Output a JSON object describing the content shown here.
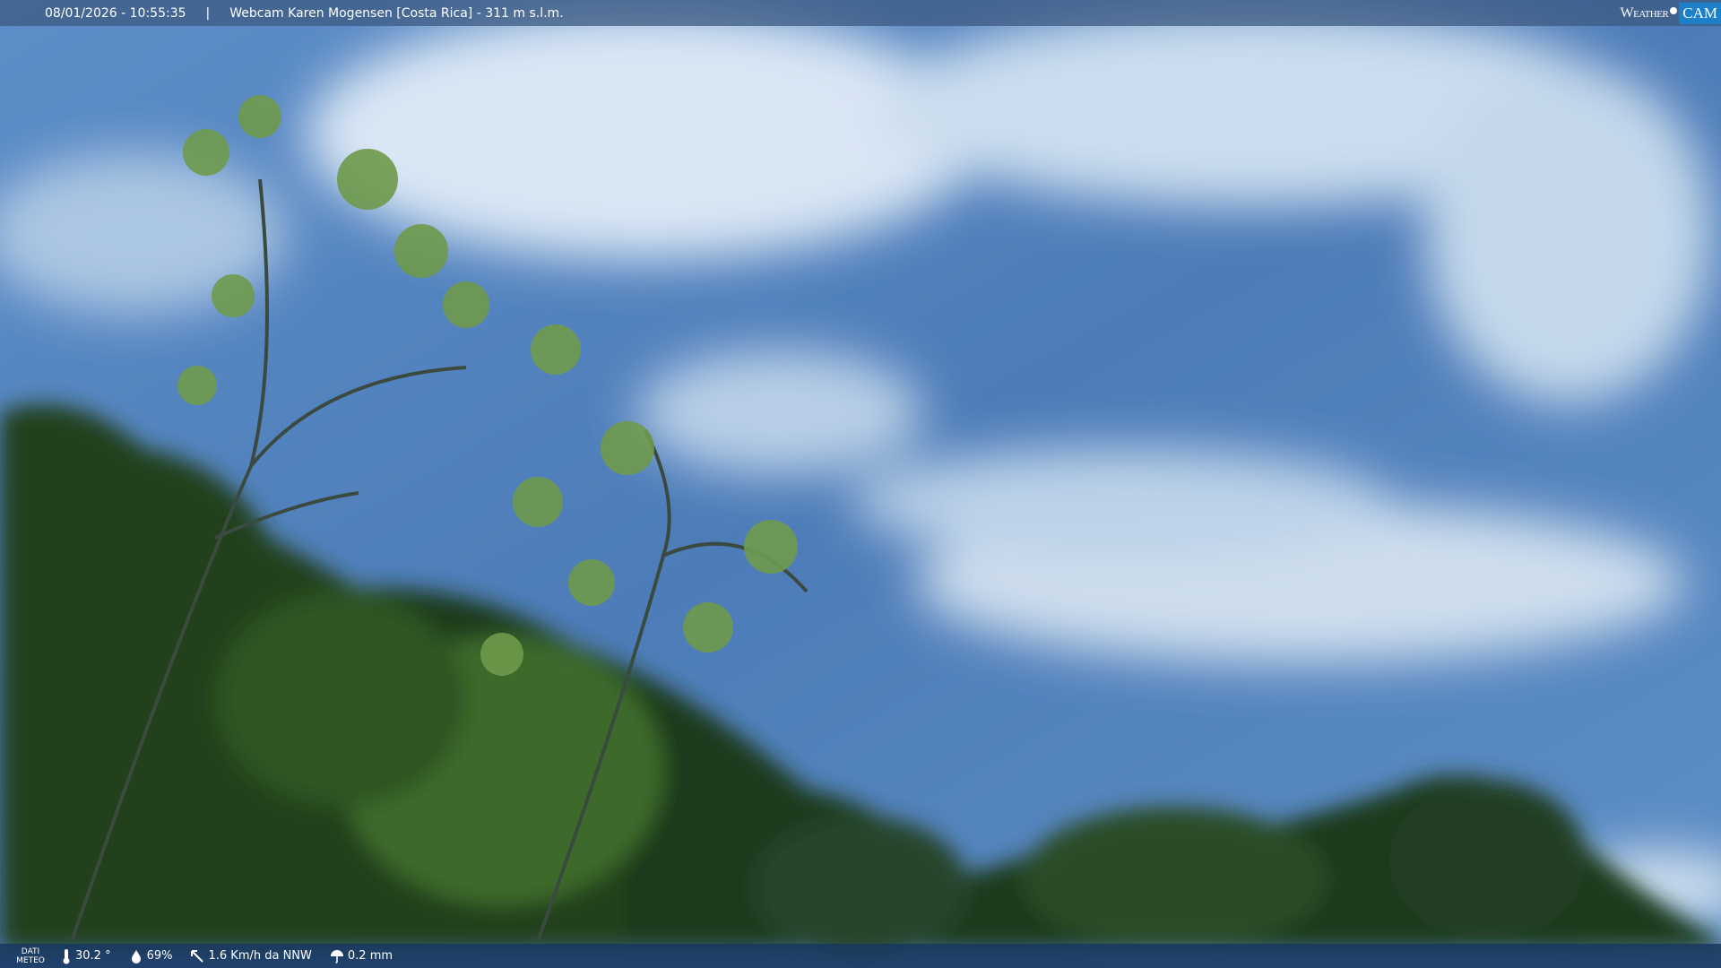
{
  "topbar": {
    "timestamp": "08/01/2026 - 10:55:35",
    "separator": "|",
    "title": "Webcam Karen Mogensen [Costa Rica] - 311 m s.l.m."
  },
  "brand": {
    "left": "Weather",
    "right": "CAM"
  },
  "meteo": {
    "label_line1": "DATI",
    "label_line2": "METEO",
    "temperature": "30.2 °",
    "humidity": "69%",
    "wind": "1.6 Km/h da NNW",
    "rain": "0.2 mm"
  },
  "colors": {
    "sky": "#4a78b0",
    "bar": "#1d3a60",
    "accent": "#1d7fc8"
  }
}
